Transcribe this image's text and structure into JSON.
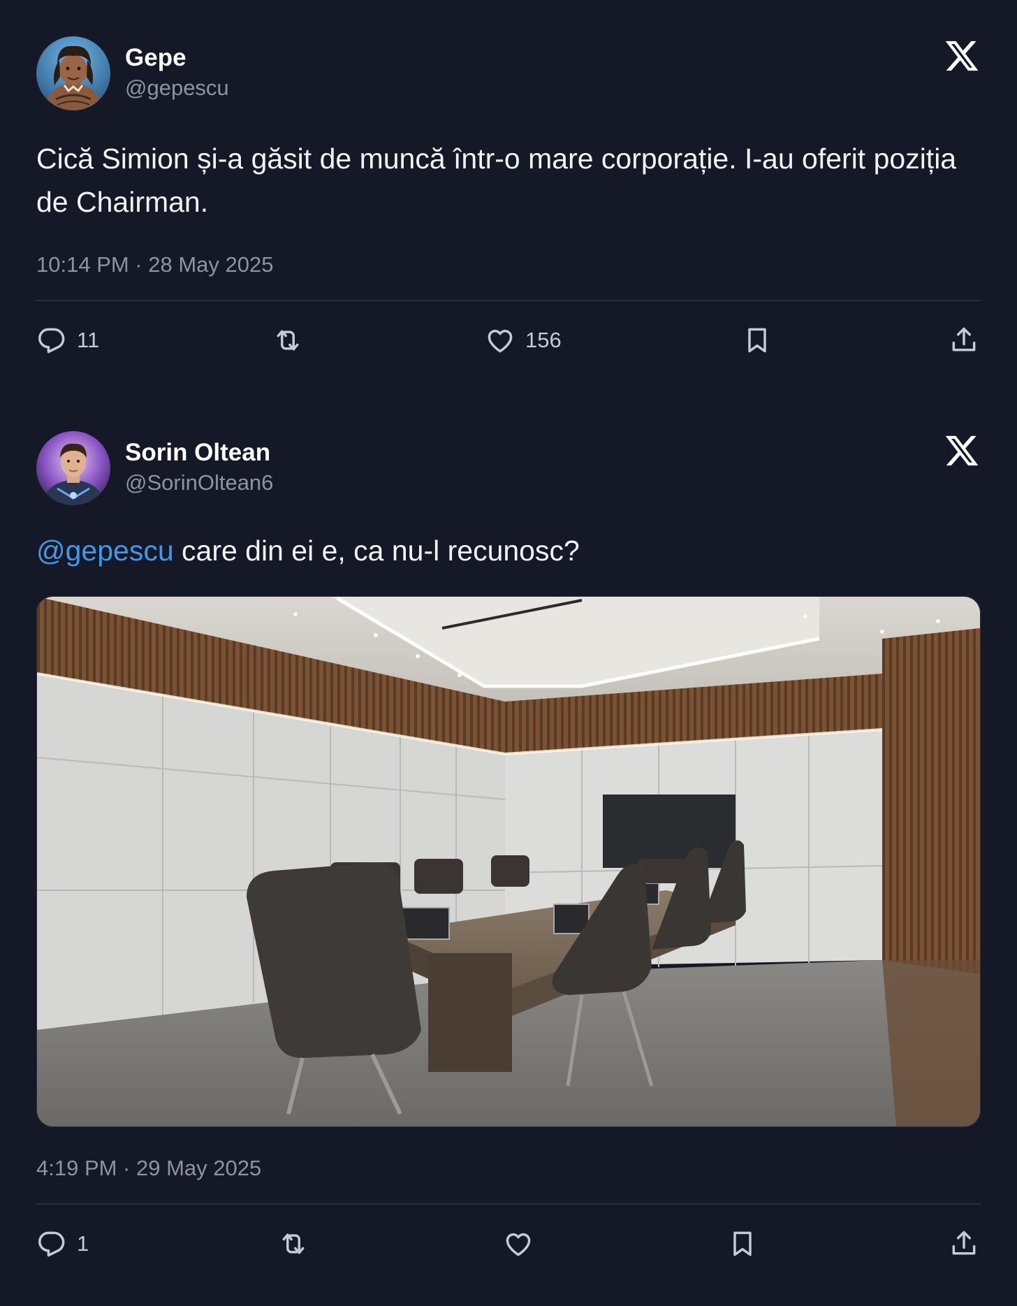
{
  "colors": {
    "background": "#151826",
    "text_primary": "#ffffff",
    "text_secondary": "#8d94a0",
    "mention": "#3f98e8",
    "divider": "#2b2f3d"
  },
  "tweets": [
    {
      "author": {
        "name": "Gepe",
        "handle": "@gepescu",
        "avatar_icon": "avatar-image"
      },
      "platform_icon": "x-logo-icon",
      "text": "Cică Simion și-a găsit de muncă într-o mare corporație. I-au oferit poziția de Chairman.",
      "timestamp": "10:14 PM · 28 May 2025",
      "actions": {
        "reply_count": "11",
        "retweet_count": "",
        "like_count": "156"
      }
    },
    {
      "author": {
        "name": "Sorin Oltean",
        "handle": "@SorinOltean6",
        "avatar_icon": "avatar-image"
      },
      "platform_icon": "x-logo-icon",
      "mention": "@gepescu",
      "text": " care din ei e, ca nu-l recunosc?",
      "media": {
        "type": "photo",
        "subject": "conference-room"
      },
      "timestamp": "4:19 PM · 29 May 2025",
      "actions": {
        "reply_count": "1",
        "retweet_count": "",
        "like_count": ""
      }
    }
  ]
}
